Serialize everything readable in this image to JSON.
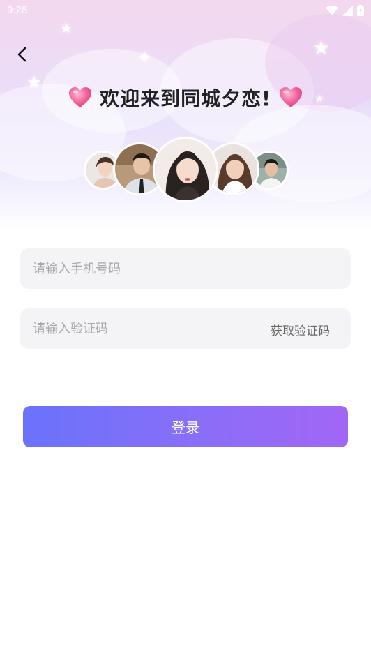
{
  "status_bar": {
    "time": "9:28"
  },
  "header": {
    "title": "欢迎来到同城夕恋!"
  },
  "avatars": [
    {
      "name": "avatar-1"
    },
    {
      "name": "avatar-2"
    },
    {
      "name": "avatar-3"
    },
    {
      "name": "avatar-4"
    },
    {
      "name": "avatar-5"
    }
  ],
  "form": {
    "phone_placeholder": "请输入手机号码",
    "phone_value": "",
    "code_placeholder": "请输入验证码",
    "code_value": "",
    "get_code_label": "获取验证码"
  },
  "login_button": {
    "label": "登录"
  },
  "colors": {
    "accent_start": "#6a72fb",
    "accent_end": "#a266f5",
    "heart": "#f0609a"
  },
  "icons": [
    "back-icon",
    "wifi-icon",
    "signal-icon",
    "battery-icon",
    "heart-icon",
    "sparkle-icon"
  ]
}
